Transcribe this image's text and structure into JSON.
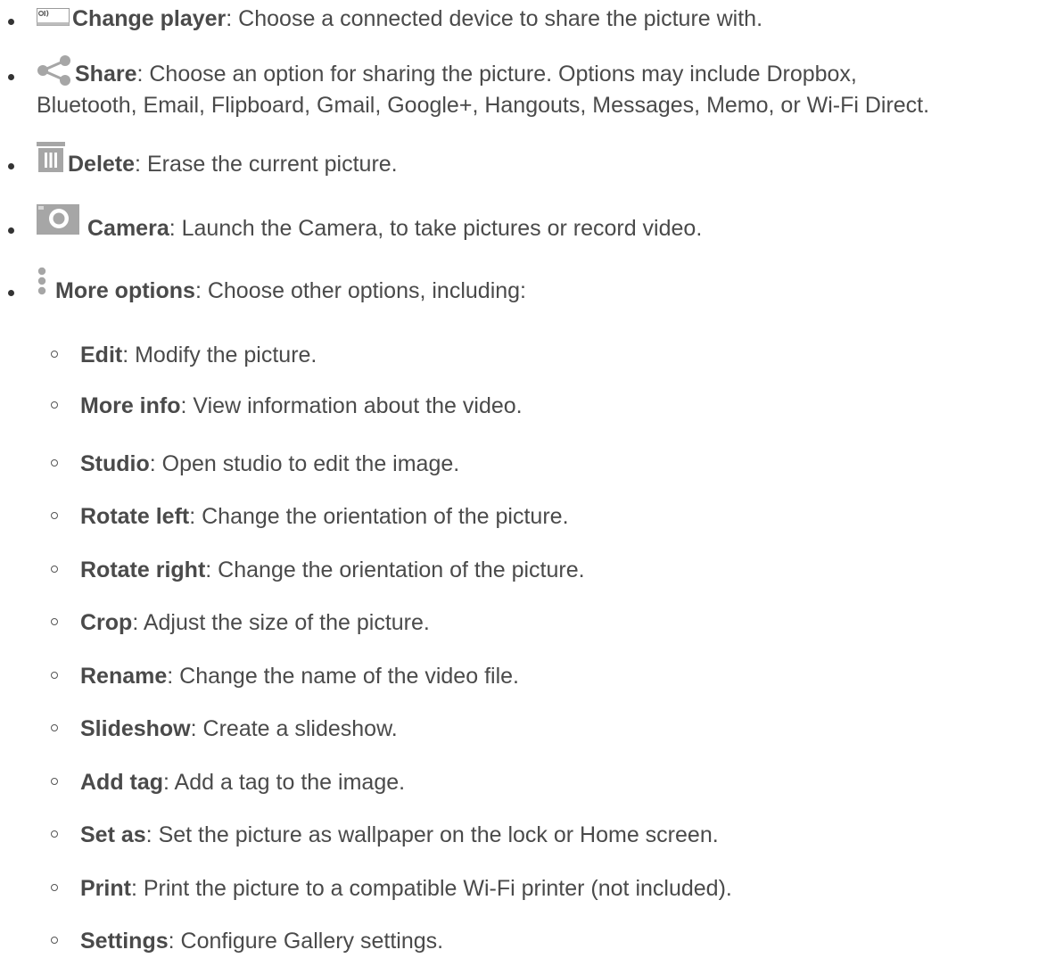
{
  "items": [
    {
      "term": "Change player",
      "desc": ": Choose a connected device to share the picture with.",
      "icon": "change-player-icon"
    },
    {
      "term": "Share",
      "desc": ": Choose an option for sharing the picture. Options may include Dropbox,",
      "desc2": "Bluetooth, Email, Flipboard, Gmail, Google+, Hangouts, Messages, Memo, or Wi-Fi Direct.",
      "icon": "share-icon"
    },
    {
      "term": "Delete",
      "desc": ": Erase the current picture.",
      "icon": "trash-icon"
    },
    {
      "term": "Camera",
      "desc": ": Launch the Camera, to take pictures or record video.",
      "icon": "camera-icon"
    },
    {
      "term": "More options",
      "desc": ": Choose other options, including:",
      "icon": "more-options-icon"
    }
  ],
  "sub_items": [
    {
      "term": "Edit",
      "desc": ": Modify the picture."
    },
    {
      "term": "More info",
      "desc": ": View information about the video."
    },
    {
      "term": "Studio",
      "desc": ": Open studio to edit the image."
    },
    {
      "term": "Rotate left",
      "desc": ": Change the orientation of the picture."
    },
    {
      "term": "Rotate right",
      "desc": ": Change the orientation of the picture."
    },
    {
      "term": "Crop",
      "desc": ": Adjust the size of the picture."
    },
    {
      "term": "Rename",
      "desc": ": Change the name of the video file."
    },
    {
      "term": "Slideshow",
      "desc": ": Create a slideshow."
    },
    {
      "term": "Add tag",
      "desc": ": Add a tag to the image."
    },
    {
      "term": "Set as",
      "desc": ": Set the picture as wallpaper on the lock or Home screen."
    },
    {
      "term": "Print",
      "desc": ": Print the picture to a compatible Wi-Fi printer (not included)."
    },
    {
      "term": "Settings",
      "desc": ": Configure Gallery settings."
    }
  ],
  "colors": {
    "text": "#4a4a4a",
    "icon_gray": "#a6a6a6"
  }
}
